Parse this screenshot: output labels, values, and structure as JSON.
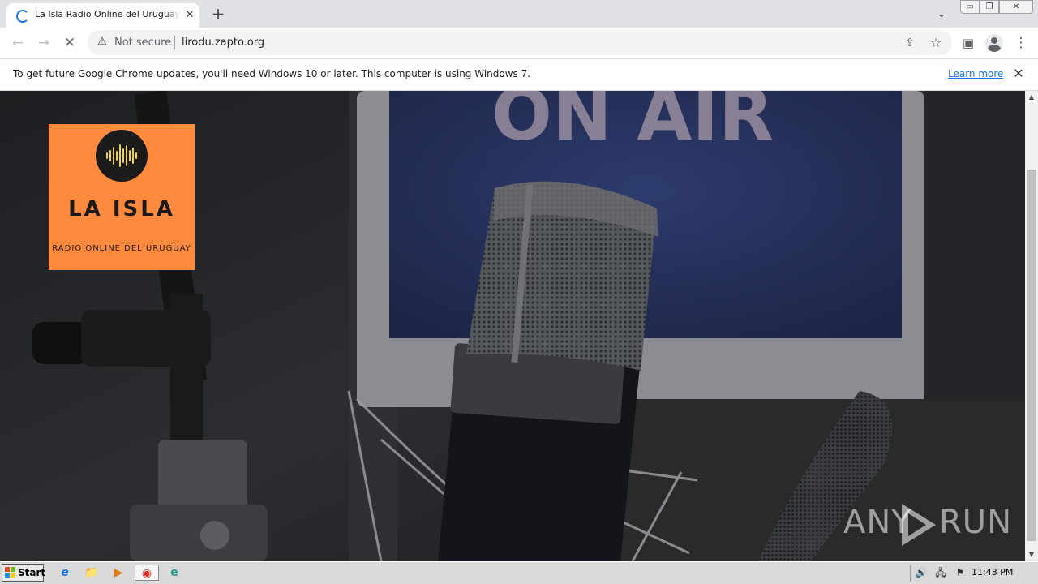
{
  "browser": {
    "tab": {
      "title": "La Isla Radio Online del Uruguay - Lil",
      "close_glyph": "✕",
      "loading": true
    },
    "new_tab_glyph": "+",
    "tab_search_glyph": "⌄",
    "window_controls": {
      "minimize": "▭",
      "maximize": "❐",
      "close": "✕"
    },
    "toolbar": {
      "back_glyph": "←",
      "forward_glyph": "→",
      "stop_glyph": "✕",
      "security_icon": "⚠",
      "security_text": "Not secure",
      "url": "lirodu.zapto.org",
      "share_glyph": "⇪",
      "bookmark_glyph": "☆",
      "sidepanel_glyph": "▣",
      "menu_glyph": "⋮"
    },
    "infobar": {
      "message": "To get future Google Chrome updates, you'll need Windows 10 or later. This computer is using Windows 7.",
      "link": "Learn more",
      "close_glyph": "✕"
    }
  },
  "page": {
    "background_sign": "ON AIR",
    "logo": {
      "title": "LA ISLA",
      "subtitle": "RADIO ONLINE DEL URUGUAY",
      "bg_color": "#ff8a3d",
      "wave_color": "#f2d33a"
    },
    "watermark": {
      "left": "ANY",
      "right": "RUN"
    }
  },
  "scrollbar": {
    "up_glyph": "▲",
    "down_glyph": "▼"
  },
  "taskbar": {
    "start_label": "Start",
    "apps": [
      {
        "name": "internet-explorer-icon",
        "glyph": "e"
      },
      {
        "name": "file-explorer-icon",
        "glyph": "📁"
      },
      {
        "name": "media-player-icon",
        "glyph": "▶"
      },
      {
        "name": "chrome-icon",
        "glyph": "◉"
      },
      {
        "name": "edge-icon",
        "glyph": "e"
      }
    ],
    "tray": {
      "volume_glyph": "🔊",
      "network_glyph": "🖧",
      "flag_glyph": "⚑",
      "clock": "11:43 PM"
    }
  }
}
